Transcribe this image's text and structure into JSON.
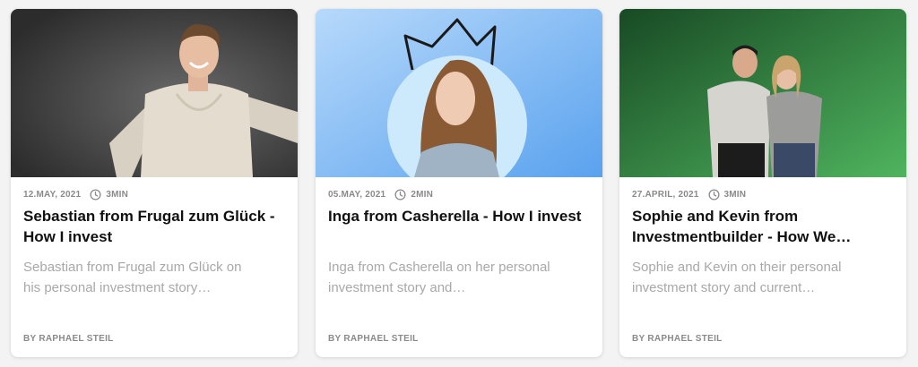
{
  "cards": [
    {
      "date": "12.MAY, 2021",
      "read_time": "3MIN",
      "title": "Sebastian from Frugal zum Glück - How I invest",
      "excerpt": "Sebastian from Frugal zum Glück on his personal investment story…",
      "author": "BY RAPHAEL STEIL",
      "image": "portrait-man-hoodie-photo",
      "accent": "#4a4a4a"
    },
    {
      "date": "05.MAY, 2021",
      "read_time": "2MIN",
      "title": "Inga from Casherella - How I invest",
      "excerpt": "Inga from Casherella on her personal investment story and…",
      "author": "BY RAPHAEL STEIL",
      "image": "portrait-woman-crown-photo",
      "accent": "#7db8f0"
    },
    {
      "date": "27.APRIL, 2021",
      "read_time": "3MIN",
      "title": "Sophie and Kevin from Investmentbuilder - How We…",
      "excerpt": "Sophie and Kevin on their personal investment story and current…",
      "author": "BY RAPHAEL STEIL",
      "image": "portrait-couple-green-photo",
      "accent": "#3f9a50"
    }
  ],
  "icons": {
    "clock": "clock-icon"
  }
}
